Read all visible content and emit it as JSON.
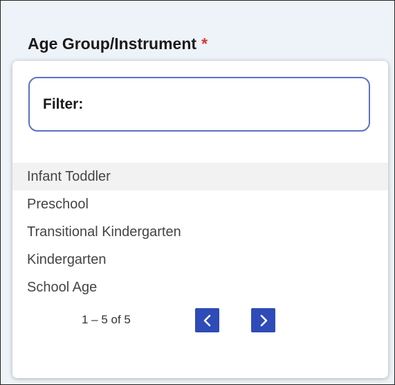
{
  "field": {
    "label": "Age Group/Instrument",
    "required_mark": "*"
  },
  "filter": {
    "label": "Filter:"
  },
  "options": [
    {
      "label": "Infant Toddler",
      "highlighted": true
    },
    {
      "label": "Preschool",
      "highlighted": false
    },
    {
      "label": "Transitional Kindergarten",
      "highlighted": false
    },
    {
      "label": "Kindergarten",
      "highlighted": false
    },
    {
      "label": "School Age",
      "highlighted": false
    }
  ],
  "pagination": {
    "range_text": "1 – 5 of 5",
    "prev_icon": "chevron-left-icon",
    "next_icon": "chevron-right-icon"
  },
  "colors": {
    "required": "#d9362b",
    "filter_border": "#5b70c6",
    "pager_button": "#2f4bb8",
    "highlight_row": "#f2f2f2",
    "backdrop": "#eef3f9"
  }
}
